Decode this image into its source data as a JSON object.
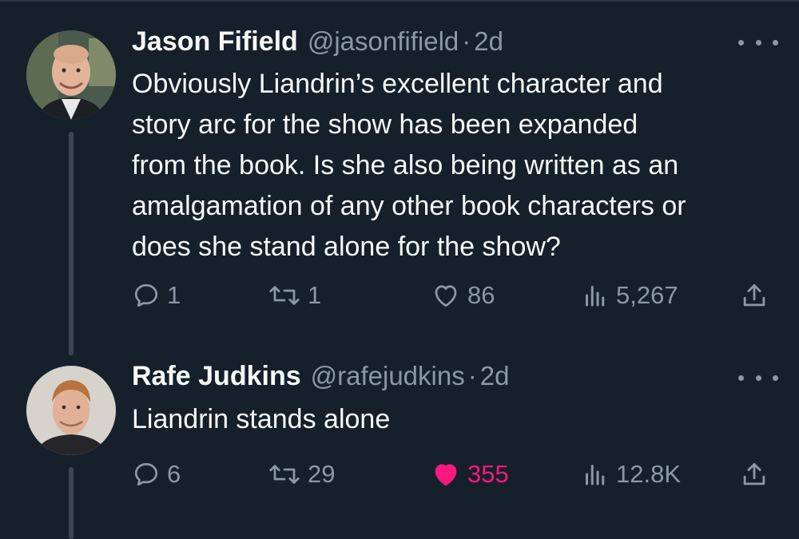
{
  "tweets": [
    {
      "name": "Jason Fifield",
      "handle": "@jasonfifield",
      "separator": "·",
      "time": "2d",
      "body_lines": [
        "Obviously Liandrin’s excellent character and",
        "story arc for the show has been expanded",
        "from the book. Is she also being written as an",
        "amalgamation of any other book characters or",
        "does she stand alone for the show?"
      ],
      "replies": "1",
      "retweets": "1",
      "likes": "86",
      "views": "5,267",
      "liked": false
    },
    {
      "name": "Rafe Judkins",
      "handle": "@rafejudkins",
      "separator": "·",
      "time": "2d",
      "body_lines": [
        "Liandrin stands alone"
      ],
      "replies": "6",
      "retweets": "29",
      "likes": "355",
      "views": "12.8K",
      "liked": true
    }
  ],
  "colors": {
    "background": "#15202b",
    "text": "#f7f9f9",
    "secondary": "#8b98a5",
    "like_active": "#f91880",
    "thread_line": "#3a4753"
  },
  "icons": [
    "reply-icon",
    "retweet-icon",
    "like-icon",
    "views-icon",
    "share-icon",
    "more-icon"
  ]
}
